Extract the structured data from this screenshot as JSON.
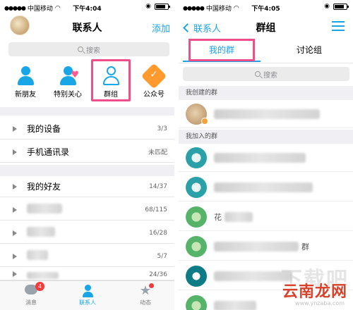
{
  "left": {
    "status": {
      "carrier": "中国移动",
      "time": "下午4:04"
    },
    "nav": {
      "title": "联系人",
      "add_label": "添加"
    },
    "search": {
      "placeholder": "搜索"
    },
    "quick": [
      {
        "label": "新朋友",
        "icon": "person-icon"
      },
      {
        "label": "特别关心",
        "icon": "person-heart-icon"
      },
      {
        "label": "群组",
        "icon": "group-icon"
      },
      {
        "label": "公众号",
        "icon": "official-account-icon"
      }
    ],
    "rows": [
      {
        "label": "我的设备",
        "count": "3/3"
      },
      {
        "label": "手机通讯录",
        "count": "未匹配"
      },
      {
        "label": "我的好友",
        "count": "14/37"
      },
      {
        "label": "",
        "count": "68/115"
      },
      {
        "label": "",
        "count": "16/28"
      },
      {
        "label": "",
        "count": "5/7"
      },
      {
        "label": "",
        "count": "24/36"
      }
    ],
    "tabbar": [
      {
        "label": "消息",
        "badge": "4"
      },
      {
        "label": "联系人"
      },
      {
        "label": "动态"
      }
    ]
  },
  "right": {
    "status": {
      "carrier": "中国移动",
      "time": "下午4:05"
    },
    "nav": {
      "back_label": "联系人",
      "title": "群组"
    },
    "tabs": [
      {
        "label": "我的群"
      },
      {
        "label": "讨论组"
      }
    ],
    "search": {
      "placeholder": "搜索"
    },
    "sections": {
      "created": "我创建的群",
      "joined": "我加入的群"
    },
    "groups_joined_partial": [
      "花",
      "群"
    ]
  },
  "watermark": {
    "text": "云南龙网",
    "url": "www.ynzaba.com"
  },
  "colors": {
    "accent": "#1aa3e8",
    "highlight": "#ee4f8b",
    "badge_red": "#f43b3b"
  }
}
